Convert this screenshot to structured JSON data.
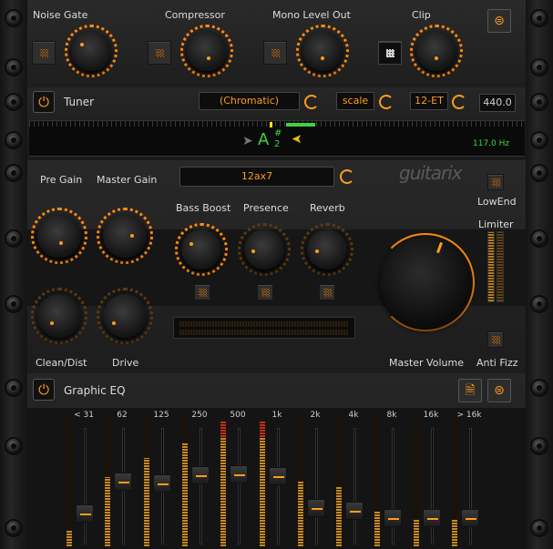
{
  "top_bar": {
    "units": [
      {
        "label": "Noise Gate",
        "active": false,
        "knob_level": 0.55
      },
      {
        "label": "Compressor",
        "active": false,
        "knob_level": 0.5
      },
      {
        "label": "Mono Level Out",
        "active": false,
        "knob_level": 0.5
      },
      {
        "label": "Clip",
        "active": true,
        "knob_level": 0.5
      }
    ],
    "settings_icon": "mixer-icon"
  },
  "tuner": {
    "title": "Tuner",
    "mode": "(Chromatic)",
    "scale": "scale",
    "temperament": "12-ET",
    "reference": "440.0",
    "note": "A",
    "accidental": "#",
    "octave": "2",
    "frequency": "117.0 Hz"
  },
  "amp": {
    "tube": "12ax7",
    "brand": "guitarix",
    "knobs": {
      "pre_gain": "Pre Gain",
      "master_gain": "Master Gain",
      "bass_boost": "Bass Boost",
      "presence": "Presence",
      "reverb": "Reverb",
      "clean_dist": "Clean/Dist",
      "drive": "Drive",
      "master_volume": "Master Volume"
    },
    "lowend": "LowEnd",
    "limiter": "Limiter",
    "antifizz": "Anti Fizz"
  },
  "graphic_eq": {
    "title": "Graphic EQ",
    "bands": [
      {
        "label": "< 31",
        "gain": -0.55,
        "meter": 0.12
      },
      {
        "label": "62",
        "gain": 0.1,
        "meter": 0.55
      },
      {
        "label": "125",
        "gain": 0.05,
        "meter": 0.7
      },
      {
        "label": "250",
        "gain": 0.22,
        "meter": 0.82
      },
      {
        "label": "500",
        "gain": 0.25,
        "meter": 0.95
      },
      {
        "label": "1k",
        "gain": 0.2,
        "meter": 0.95
      },
      {
        "label": "2k",
        "gain": -0.45,
        "meter": 0.52
      },
      {
        "label": "4k",
        "gain": -0.5,
        "meter": 0.47
      },
      {
        "label": "8k",
        "gain": -0.65,
        "meter": 0.28
      },
      {
        "label": "16k",
        "gain": -0.65,
        "meter": 0.22
      },
      {
        "label": "> 16k",
        "gain": -0.65,
        "meter": 0.22
      }
    ]
  },
  "colors": {
    "accent": "#ff9d1a",
    "tuner_green": "#3fd13f",
    "bg": "#1f1f1f"
  }
}
